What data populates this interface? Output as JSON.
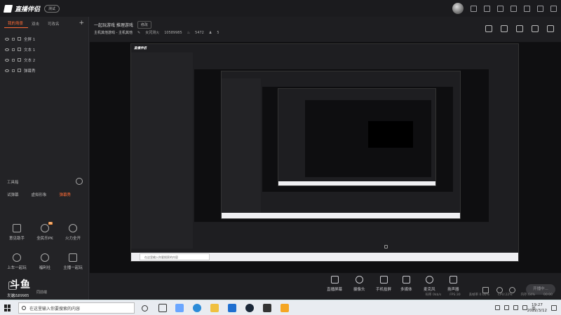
{
  "app": {
    "name": "直播伴侣",
    "version_badge": "测试"
  },
  "left_panel": {
    "tabs": [
      "我的场景",
      "双击",
      "可改名"
    ],
    "scenes": [
      "全屏 1",
      "文本 1",
      "文本 2",
      "弹幕秀"
    ],
    "tools_title": "工具箱",
    "tool_tabs": [
      "试弹幕",
      "虚拟形象",
      "弹幕秀"
    ],
    "tools": [
      "意见助手",
      "全民乐PK",
      "火力全开",
      "上车一起玩",
      "福利社",
      "主播一起玩"
    ],
    "tool_pk_badge": "PK",
    "extra_tool": "发送...",
    "douyu_logo": "斗鱼",
    "room_id": "10589985",
    "hidden_note": "同前端"
  },
  "header": {
    "room_title": "一起玩游戏 推理游戏",
    "edit_label": "修改",
    "category": "主机其他游戏 - 主机其他",
    "host_label": "女咒测火",
    "room_number": "10589985",
    "hot_value": "5472",
    "viewers": "5"
  },
  "controls": [
    {
      "label": "直播屏幕",
      "icon": "screen-share-icon"
    },
    {
      "label": "摄像头",
      "icon": "camera-icon"
    },
    {
      "label": "手机投屏",
      "icon": "phone-cast-icon"
    },
    {
      "label": "多媒体",
      "icon": "media-icon"
    },
    {
      "label": "麦克风",
      "icon": "microphone-icon"
    },
    {
      "label": "扬声器",
      "icon": "speaker-icon"
    }
  ],
  "start_button": "开播中...",
  "status_bar": [
    "码率 0kb/s",
    "FPS:30",
    "丢帧率 0.00%",
    "CPU:22%",
    "内存:64%",
    "00:00"
  ],
  "inner_preview": {
    "title": "直播伴侣",
    "search_placeholder": "在这里输入你要搜索的内容"
  },
  "taskbar": {
    "search_placeholder": "在这里输入你要搜索的内容",
    "ime": "英",
    "time": "19:27",
    "date": "2022/3/12"
  },
  "colors": {
    "accent": "#ff6b35",
    "bg": "#1e1e21",
    "panel": "#232326"
  }
}
